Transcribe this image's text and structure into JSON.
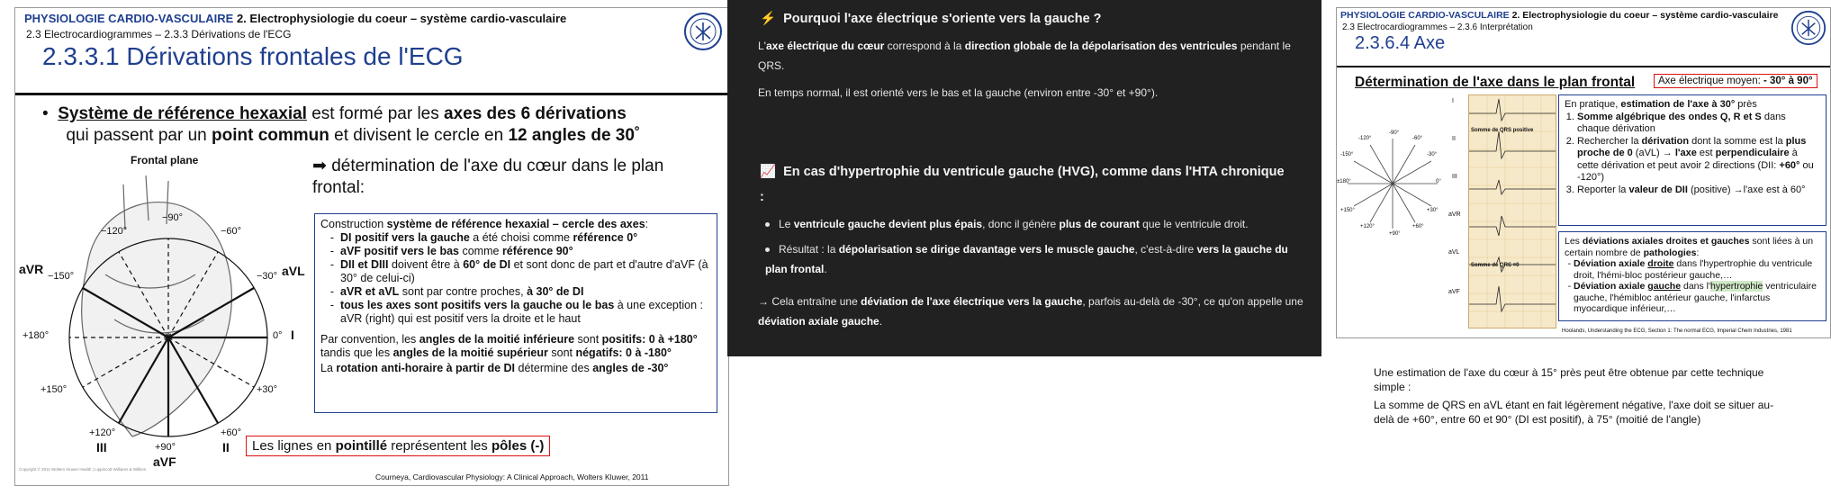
{
  "slide1": {
    "course": "PHYSIOLOGIE CARDIO-VASCULAIRE",
    "course_suffix": " 2. Electrophysiologie du coeur – système cardio-vasculaire",
    "subsection": "2.3 Electrocardiogrammes – 2.3.3 Dérivations de l'ECG",
    "title": "2.3.3.1 Dérivations frontales de l'ECG",
    "bullet": {
      "lead_bold": "Système de référence hexaxial",
      "t1": " est formé par les ",
      "b1": "axes des 6 dérivations",
      "t2": " qui passent par un ",
      "b2": "point commun",
      "t3": " et divisent le cercle en ",
      "b3": "12 angles de 30˚"
    },
    "arrow_text": "➡ détermination de l'axe du cœur dans le plan frontal:",
    "figure_label": "Frontal plane",
    "axis_labels": {
      "m90": "−90°",
      "m120": "−120°",
      "m60": "−60°",
      "m150": "−150°",
      "m30": "−30°",
      "p0": "0°",
      "p180": "+180°",
      "p150": "+150°",
      "p30": "+30°",
      "p120": "+120°",
      "p90": "+90°",
      "p60": "+60°",
      "aVR": "aVR",
      "aVL": "aVL",
      "I": "I",
      "II": "II",
      "III": "III",
      "aVF": "aVF"
    },
    "construction": {
      "intro_a": "Construction ",
      "intro_b": "système de référence hexaxial – cercle des axes",
      "intro_c": ":",
      "items": [
        {
          "a": "DI positif vers la gauche",
          "b": " a été choisi comme ",
          "c": "référence 0°"
        },
        {
          "a": "aVF positif vers le bas",
          "b": " comme ",
          "c": "référence 90°"
        },
        {
          "a": "DII et DIII",
          "b": " doivent être à ",
          "c": "60° de DI",
          "d": " et sont donc de part et d'autre d'aVF (à 30° de celui-ci)"
        },
        {
          "a": "aVR et aVL",
          "b": " sont par contre proches, ",
          "c": "à 30° de DI"
        },
        {
          "a": "tous les axes sont positifs vers la gauche ou le bas",
          "b": " à une exception : aVR (right) qui est positif vers la droite et le haut"
        }
      ],
      "p1_a": "Par convention, les ",
      "p1_b": "angles de la moitié inférieure",
      "p1_c": " sont ",
      "p1_d": "positifs: 0 à +180°",
      "p1_e": " tandis que les ",
      "p1_f": "angles de la moitié supérieur",
      "p1_g": " sont ",
      "p1_h": "négatifs: 0 à -180°",
      "p2_a": "La ",
      "p2_b": "rotation anti-horaire à partir de DI",
      "p2_c": " détermine des ",
      "p2_d": "angles de -30°"
    },
    "poles": {
      "a": "Les lignes en ",
      "b": "pointillé",
      "c": " représentent les ",
      "d": "pôles (-)"
    },
    "citation": "Courneya, Cardiovascular Physiology: A Clinical Approach, Wolters Kluwer, 2011",
    "copyright": "Copyright © 2011 Wolters Kluwer Health | Lippincott Williams & Wilkins"
  },
  "slide2": {
    "h1_icon": "⚡",
    "h1": "Pourquoi l'axe électrique s'oriente vers la gauche ?",
    "p1": {
      "a": "L'",
      "b": "axe électrique du cœur",
      "c": " correspond à la ",
      "d": "direction globale de la dépolarisation des ventricules",
      "e": " pendant le QRS."
    },
    "p2": "En temps normal, il est orienté vers le bas et la gauche (environ entre -30° et +90°).",
    "h2_icon": "📈",
    "h2": "En cas d'hypertrophie du ventricule gauche (HVG), comme dans l'HTA chronique",
    "h2_tail": ":",
    "li1": {
      "a": "Le ",
      "b": "ventricule gauche devient plus épais",
      "c": ", donc il génère ",
      "d": "plus de courant",
      "e": " que le ventricule droit."
    },
    "li2": {
      "a": "Résultat : la ",
      "b": "dépolarisation se dirige davantage vers le muscle gauche",
      "c": ", c'est-à-dire ",
      "d": "vers la gauche du plan frontal",
      "e": "."
    },
    "p3": {
      "a": "→ Cela entraîne une ",
      "b": "déviation de l'axe électrique vers la gauche",
      "c": ", parfois au-delà de -30°, ce qu'on appelle une ",
      "d": "déviation axiale gauche",
      "e": "."
    }
  },
  "slide3": {
    "course": "PHYSIOLOGIE CARDIO-VASCULAIRE",
    "course_suffix": " 2. Electrophysiologie du coeur – système cardio-vasculaire",
    "subsection": "2.3 Electrocardiogrammes – 2.3.6 Interprétation",
    "title": "2.3.6.4 Axe",
    "det_title": "Détermination de l'axe dans le plan frontal",
    "moyen_a": "Axe électrique moyen: ",
    "moyen_b": "- 30° à 90°",
    "pratique": {
      "a": "En pratique, ",
      "b": "estimation de l'axe à 30°",
      "c": " près"
    },
    "steps": [
      {
        "a": "Somme algébrique des ondes Q, R et S",
        "b": " dans chaque dérivation"
      },
      {
        "a": "Rechercher la ",
        "b": "dérivation",
        "c": " dont la somme est la ",
        "d": "plus proche de 0",
        "e": " (aVL) → ",
        "f": "l'axe",
        "g": " est ",
        "h": "perpendiculaire",
        "i": " à cette dérivation et peut avoir 2 directions (DII: ",
        "j": "+60°",
        "k": " ou -120°)"
      },
      {
        "a": "Reporter la ",
        "b": "valeur de DII",
        "c": " (positive) →l'axe est à 60°"
      }
    ],
    "dev_intro": {
      "a": "Les ",
      "b": "déviations axiales droites et gauches",
      "c": " sont liées à un certain nombre de ",
      "d": "pathologies",
      "e": ":"
    },
    "dev_items": [
      {
        "a": "Déviation axiale ",
        "b": "droite",
        "c": " dans l'hypertrophie du ventricule droit, l'hémi-bloc postérieur gauche,…"
      },
      {
        "a": "Déviation axiale ",
        "b": "gauche",
        "c": " dans l'",
        "d": "hypertrophie",
        "e": " ventriculaire gauche, l'hémibloc antérieur gauche, l'infarctus myocardique inférieur,…"
      }
    ],
    "ecg_labels": {
      "top": "Somme de QRS positive",
      "mid": "Somme de QRS =0",
      "leads": [
        "I",
        "II",
        "III",
        "aVR",
        "aVL",
        "aVF"
      ]
    },
    "hex_labels": {
      "m90": "-90°",
      "m60": "-60°",
      "m120": "-120°",
      "m30": "-30°",
      "m150": "-150°",
      "p0": "0°",
      "p180": "±180°",
      "p30": "+30°",
      "p150": "+150°",
      "p60": "+60°",
      "p120": "+120°",
      "p90": "+90°"
    },
    "citation": "Hoolands, Understanding the ECG, Section 1: The normal ECG, Imperial Chem Industries, 1981",
    "below_p1": "Une estimation de l'axe du cœur à 15° près peut être obtenue par cette technique simple :",
    "below_p2": "La somme de QRS en aVL étant en fait légèrement négative, l'axe doit se situer au-delà de +60°, entre 60 et 90° (DI est positif), à 75° (moitié de l'angle)"
  }
}
